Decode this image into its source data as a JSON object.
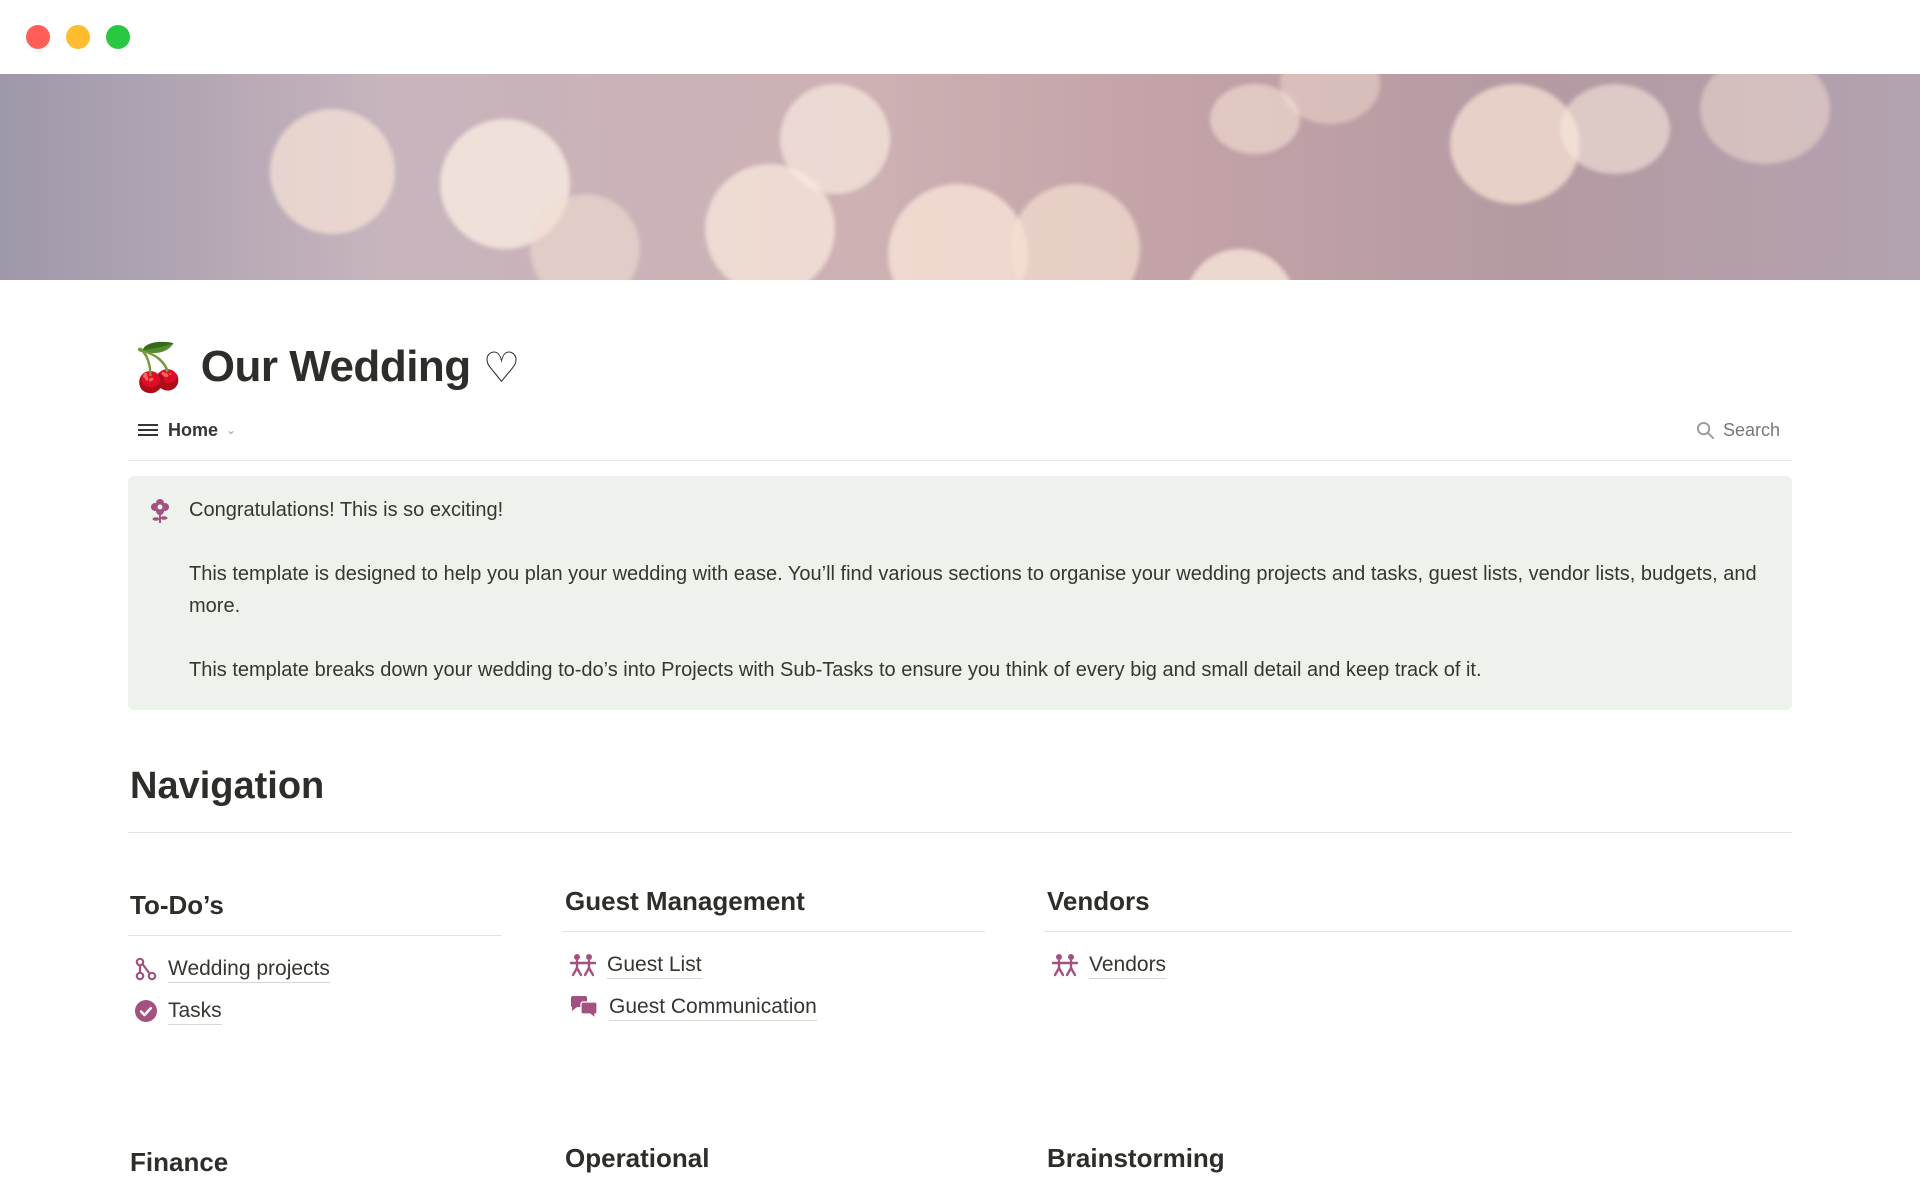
{
  "page": {
    "title": "Our Wedding",
    "title_emoji": "🍒",
    "title_suffix": "♡"
  },
  "viewbar": {
    "view_label": "Home",
    "search_label": "Search"
  },
  "callout": {
    "line1": "Congratulations! This is so exciting!",
    "line2": "This template is designed to help you plan your wedding with ease. You’ll find various sections to organise your wedding projects and tasks, guest lists, vendor lists, budgets, and more.",
    "line3": "This template breaks down your wedding to-do’s into Projects with Sub-Tasks to ensure you think of every big and small detail and keep track of it."
  },
  "navigation": {
    "heading": "Navigation",
    "todos": {
      "title": "To-Do’s",
      "links": [
        {
          "label": "Wedding projects",
          "icon": "project-nodes-icon"
        },
        {
          "label": "Tasks",
          "icon": "check-circle-icon"
        }
      ]
    },
    "guests": {
      "title": "Guest Management",
      "links": [
        {
          "label": "Guest List",
          "icon": "people-icon"
        },
        {
          "label": "Guest Communication",
          "icon": "chat-bubbles-icon"
        }
      ]
    },
    "vendors": {
      "title": "Vendors",
      "links": [
        {
          "label": "Vendors",
          "icon": "people-icon"
        }
      ]
    },
    "finance_title": "Finance",
    "operational_title": "Operational",
    "brainstorming_title": "Brainstorming"
  },
  "colors": {
    "accent": "#a3527f",
    "callout_bg": "#edf3ec"
  }
}
